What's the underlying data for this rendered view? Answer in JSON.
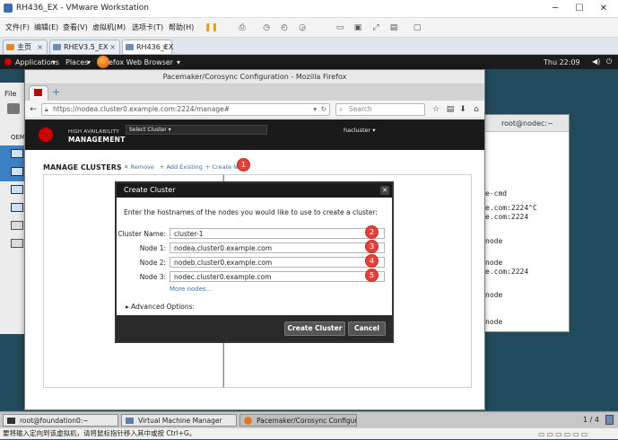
{
  "vmware": {
    "title": "RH436_EX - VMware Workstation",
    "menu": [
      "文件(F)",
      "编辑(E)",
      "查看(V)",
      "虚拟机(M)",
      "选项卡(T)",
      "帮助(H)"
    ],
    "tabs": [
      {
        "label": "主页"
      },
      {
        "label": "RHEV3.5_EX"
      },
      {
        "label": "RH436_EX"
      }
    ]
  },
  "gnome": {
    "applications": "Applications",
    "places": "Places",
    "firefox_task": "efox Web Browser",
    "clock": "Thu 22:09"
  },
  "virt_manager": {
    "file_menu": "File",
    "col": "QEM"
  },
  "terminal": {
    "title": "root@nodec:~",
    "lines": [
      "e-cmd",
      "e.com:2224^C",
      "e.com:2224",
      "node",
      "node",
      "e.com:2224",
      "node",
      "node"
    ]
  },
  "firefox": {
    "window_title": "Pacemaker/Corosync Configuration - Mozilla Firefox",
    "url": "https://nodea.cluster0.example.com:2224/manage#",
    "search_placeholder": "Search"
  },
  "pcs": {
    "brand_line1": "HIGH AVAILABILITY",
    "brand_line2": "MANAGEMENT",
    "select_cluster": "Select Cluster",
    "user": "hacluster",
    "page_title": "MANAGE CLUSTERS",
    "actions": {
      "remove": "Remove",
      "add_existing": "Add Existing",
      "create_new": "Create New"
    }
  },
  "dialog": {
    "title": "Create Cluster",
    "intro": "Enter the hostnames of the nodes you would like to use to create a cluster:",
    "fields": [
      {
        "label": "Cluster Name:",
        "value": "cluster-1",
        "badge": "2"
      },
      {
        "label": "Node 1:",
        "value": "nodea.cluster0.example.com",
        "badge": "3"
      },
      {
        "label": "Node 2:",
        "value": "nodeb.cluster0.example.com",
        "badge": "4"
      },
      {
        "label": "Node 3:",
        "value": "nodec.cluster0.example.com",
        "badge": "5"
      }
    ],
    "more_nodes": "More nodes...",
    "advanced": "Advanced Options:",
    "create_button": "Create Cluster",
    "cancel_button": "Cancel",
    "create_new_badge": "1"
  },
  "taskbar": {
    "items": [
      "root@foundation0:~",
      "Virtual Machine Manager",
      "Pacemaker/Corosync Configuratio..."
    ],
    "pager": "1 / 4"
  },
  "status_bar": "要将输入定向到该虚拟机，请将鼠标指针移入其中或按 Ctrl+G。",
  "colors": {
    "badge": "#e0433a",
    "link": "#3a6fb0",
    "header": "#1a1a1a",
    "brand_red": "#cc0000"
  }
}
